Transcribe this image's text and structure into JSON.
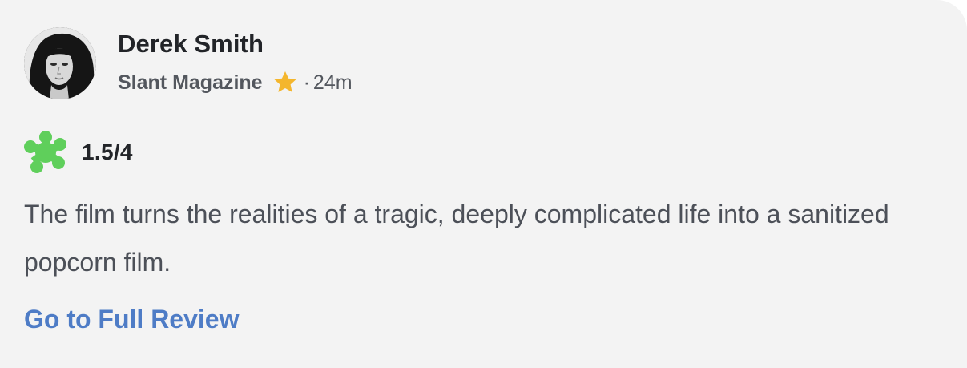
{
  "review": {
    "author_name": "Derek Smith",
    "publication": "Slant Magazine",
    "separator": "·",
    "time_ago": "24m",
    "score": "1.5/4",
    "quote": "The film turns the realities of a tragic, deeply complicated life into a sanitized popcorn film.",
    "link_label": "Go to Full Review"
  },
  "icons": {
    "top_critic": "star-icon",
    "rating": "rotten-splat-icon",
    "avatar": "critic-avatar"
  },
  "colors": {
    "card_background": "#f3f3f3",
    "star": "#f4b62d",
    "splat": "#5fcf5b",
    "link": "#4e7cc6",
    "body_text": "#4c5058"
  }
}
